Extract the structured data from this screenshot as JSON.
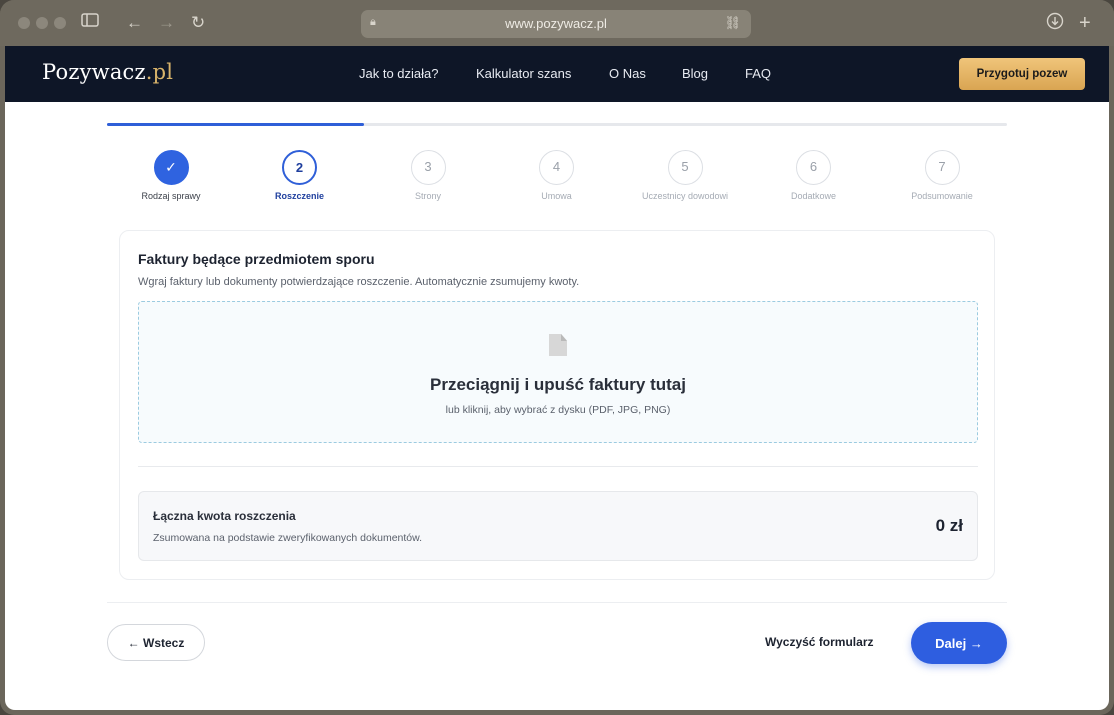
{
  "browser": {
    "url": "www.pozywacz.pl",
    "icons": [
      "sidebar-icon",
      "back-arrow-icon",
      "forward-arrow-icon",
      "reload-icon",
      "lock-icon",
      "link-icon",
      "download-icon",
      "new-tab-icon"
    ]
  },
  "nav": {
    "logo_main": "Pozywacz",
    "logo_tld": ".pl",
    "links": [
      "Jak to działa?",
      "Kalkulator szans",
      "O Nas",
      "Blog",
      "FAQ"
    ],
    "cta": "Przygotuj pozew"
  },
  "progress": {
    "fraction": 0.2857,
    "color": "#2f5fd8"
  },
  "steps": [
    {
      "number": "✓",
      "label": "Rodzaj sprawy",
      "state": "done"
    },
    {
      "number": "2",
      "label": "Roszczenie",
      "state": "active"
    },
    {
      "number": "3",
      "label": "Strony",
      "state": "pending"
    },
    {
      "number": "4",
      "label": "Umowa",
      "state": "pending"
    },
    {
      "number": "5",
      "label": "Uczestnicy dowodowi",
      "state": "pending"
    },
    {
      "number": "6",
      "label": "Dodatkowe",
      "state": "pending"
    },
    {
      "number": "7",
      "label": "Podsumowanie",
      "state": "pending"
    }
  ],
  "card": {
    "title": "Faktury będące przedmiotem sporu",
    "description": "Wgraj faktury lub dokumenty potwierdzające roszczenie. Automatycznie zsumujemy kwoty.",
    "dropzone": {
      "icon": "file-icon",
      "title": "Przeciągnij i upuść faktury tutaj",
      "subtitle": "lub kliknij, aby wybrać z dysku (PDF, JPG, PNG)"
    },
    "total": {
      "label": "Łączna kwota roszczenia",
      "subtitle": "Zsumowana na podstawie zweryfikowanych dokumentów.",
      "value": "0 zł"
    }
  },
  "footer": {
    "back": "← Wstecz",
    "clear": "Wyczyść formularz",
    "next": "Dalej →"
  },
  "colors": {
    "accent": "#2e5ee0",
    "navbar": "#0e1627",
    "cta": "#e3b062"
  }
}
